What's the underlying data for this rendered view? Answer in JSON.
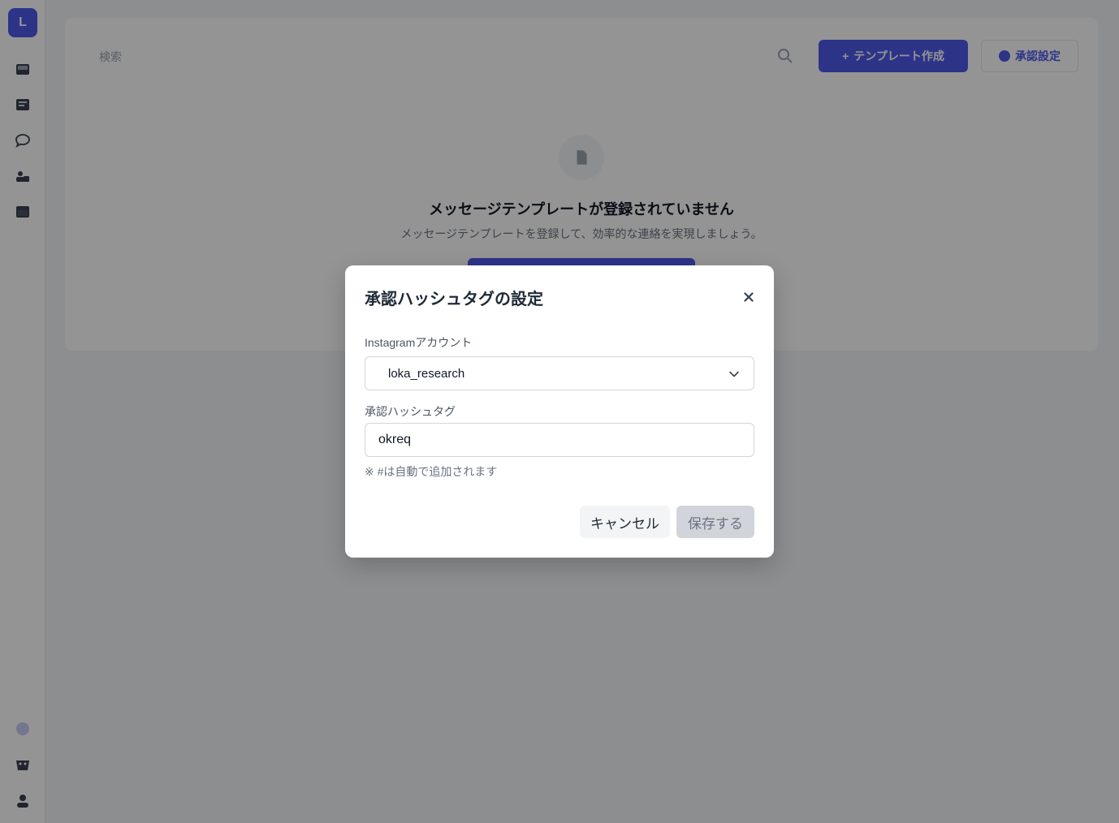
{
  "background": {
    "logo_text": "L",
    "search_placeholder": "検索",
    "create_button_label": "テンプレート作成",
    "hashtag_button_label": "承認設定",
    "empty_title": "メッセージテンプレートが登録されていません",
    "empty_description": "メッセージテンプレートを登録して、効率的な連絡を実現しましょう。",
    "sidebar_icons": [
      "inbox-icon",
      "list-icon",
      "chat-icon",
      "users-icon",
      "calendar-icon",
      "help-icon",
      "shop-icon",
      "account-icon"
    ]
  },
  "modal": {
    "title": "承認ハッシュタグの設定",
    "account_label": "Instagramアカウント",
    "account_value": "loka_research",
    "hashtag_label": "承認ハッシュタグ",
    "hashtag_value": "okreq",
    "hint": "※ #は自動で追加されます",
    "cancel_label": "キャンセル",
    "save_label": "保存する"
  },
  "colors": {
    "accent": "#4f5bea",
    "overlay": "rgba(0,0,0,0.42)",
    "disabled_button": "#d1d5db"
  }
}
